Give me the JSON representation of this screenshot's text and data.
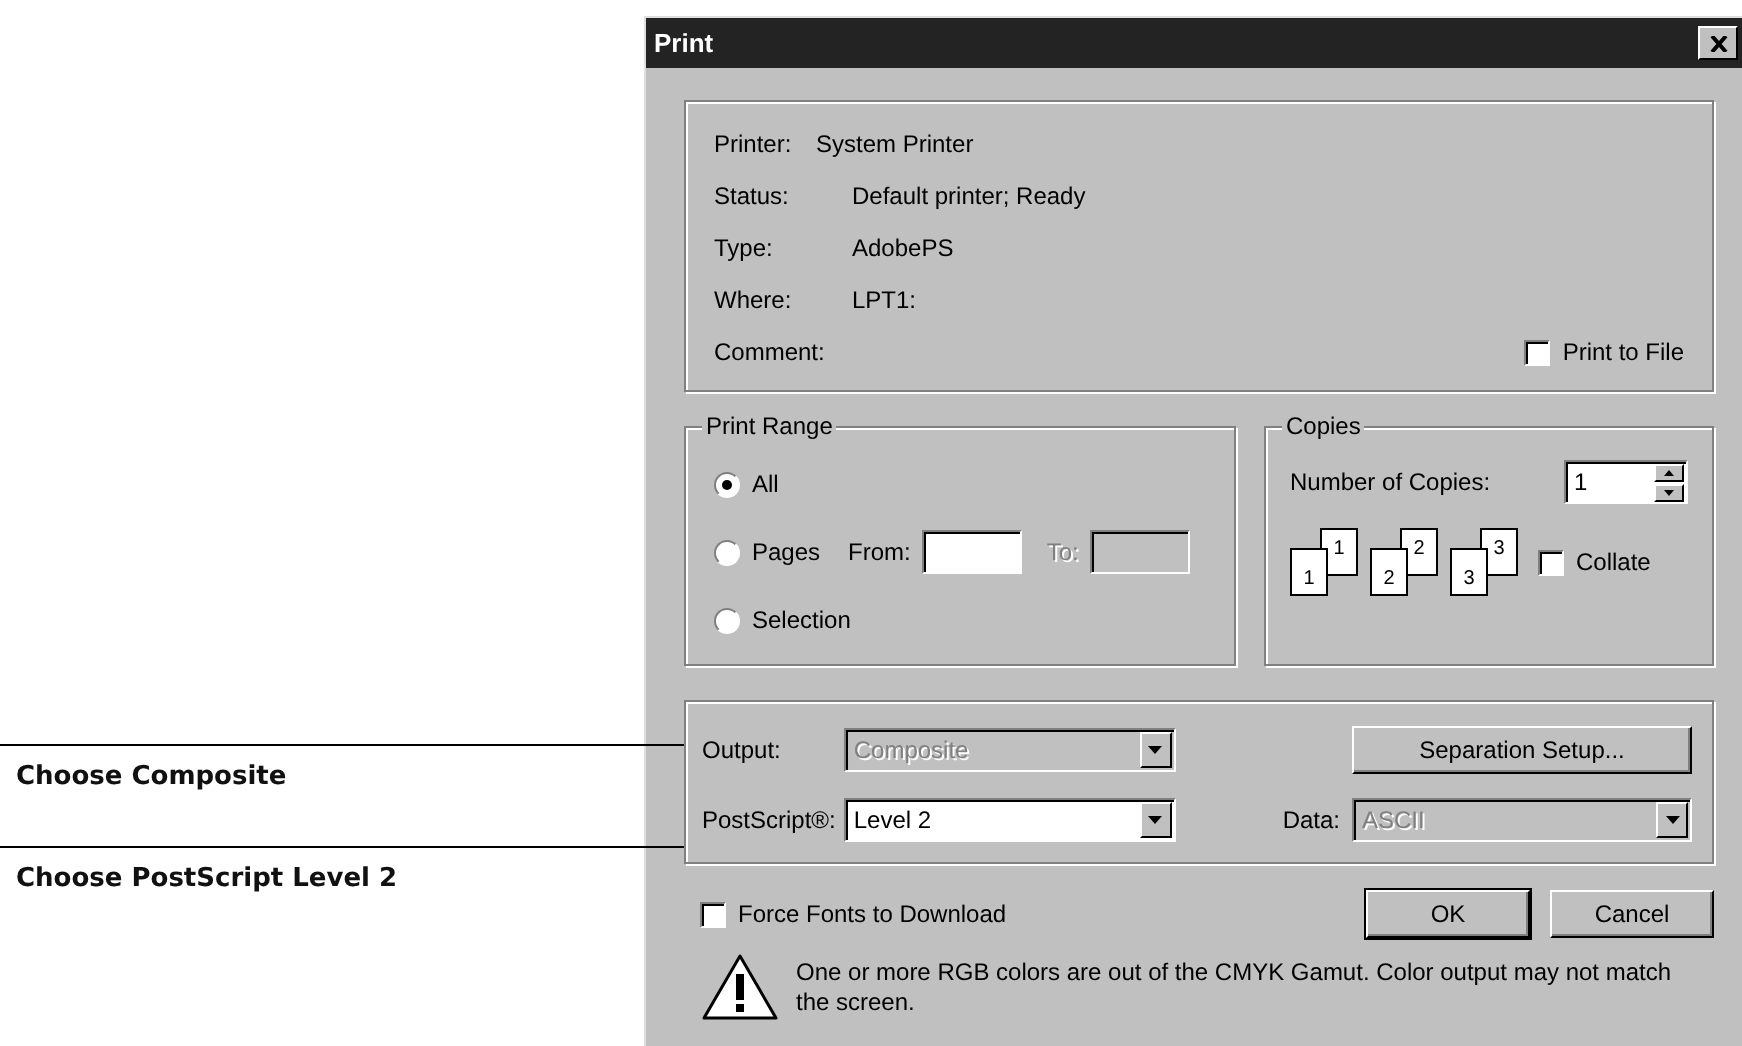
{
  "callouts": [
    {
      "label": "Choose Composite"
    },
    {
      "label": "Choose PostScript Level 2"
    }
  ],
  "window": {
    "title": "Print"
  },
  "printer": {
    "fields": [
      {
        "label": "Printer:",
        "value": "System Printer"
      },
      {
        "label": "Status:",
        "value": "Default printer; Ready"
      },
      {
        "label": "Type:",
        "value": "AdobePS"
      },
      {
        "label": "Where:",
        "value": "LPT1:"
      },
      {
        "label": "Comment:"
      }
    ],
    "print_to_file": {
      "label": "Print to File",
      "checked": false
    }
  },
  "print_range": {
    "title": "Print Range",
    "options": [
      {
        "kind": "plain",
        "label": "All",
        "selected": true
      },
      {
        "kind": "range",
        "label": "Pages",
        "selected": false,
        "from_label": "From:",
        "to_label": "To:",
        "to_disabled": true
      },
      {
        "kind": "plain",
        "label": "Selection",
        "selected": false
      }
    ]
  },
  "copies": {
    "title": "Copies",
    "label": "Number of Copies:",
    "value": "1",
    "pages": [
      "1",
      "1",
      "2",
      "2",
      "3",
      "3"
    ],
    "collate": {
      "label": "Collate",
      "checked": false
    }
  },
  "output": {
    "output_label": "Output:",
    "output_value": "Composite",
    "output_disabled": true,
    "separation_button": "Separation Setup...",
    "postscript_label": "PostScript®:",
    "postscript_value": "Level 2",
    "postscript_disabled": false,
    "data_label": "Data:",
    "data_value": "ASCII",
    "data_disabled": true
  },
  "force_fonts": {
    "label": "Force Fonts to Download",
    "checked": false
  },
  "buttons": [
    {
      "label": "OK",
      "default": true
    },
    {
      "label": "Cancel",
      "default": false
    }
  ],
  "warning": "One or more RGB colors are out of the CMYK Gamut. Color output may not match the screen."
}
